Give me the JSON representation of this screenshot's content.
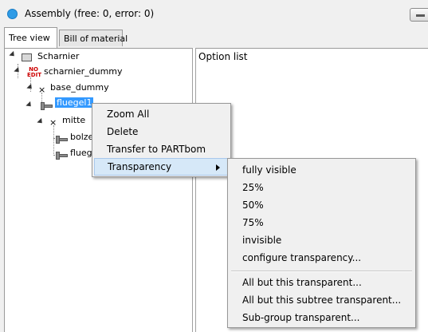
{
  "window": {
    "title": "Assembly (free: 0, error: 0)"
  },
  "tabs": [
    {
      "label": "Tree view",
      "active": true
    },
    {
      "label": "Bill of material",
      "active": false
    }
  ],
  "option_panel": {
    "label": "Option list"
  },
  "tree": {
    "nodes": [
      {
        "label": "Scharnier"
      },
      {
        "label": "scharnier_dummy"
      },
      {
        "label": "base_dummy"
      },
      {
        "label": "fluegel1",
        "selected": true
      },
      {
        "label": "mitte"
      },
      {
        "label": "bolzen"
      },
      {
        "label": "flueg"
      }
    ]
  },
  "context_menu": {
    "items": [
      {
        "label": "Zoom All"
      },
      {
        "label": "Delete"
      },
      {
        "label": "Transfer to PARTbom"
      },
      {
        "label": "Transparency",
        "has_submenu": true,
        "highlighted": true
      }
    ]
  },
  "transparency_menu": {
    "items": [
      {
        "label": "fully visible"
      },
      {
        "label": "25%"
      },
      {
        "label": "50%"
      },
      {
        "label": "75%"
      },
      {
        "label": "invisible"
      },
      {
        "label": "configure transparency..."
      },
      {
        "label": "All but this transparent..."
      },
      {
        "label": "All but this subtree transparent..."
      },
      {
        "label": "Sub-group transparent..."
      }
    ]
  },
  "colors": {
    "selection": "#3399ff",
    "menu_highlight": "#d6e8f8",
    "title_icon": "#2e9be6"
  }
}
